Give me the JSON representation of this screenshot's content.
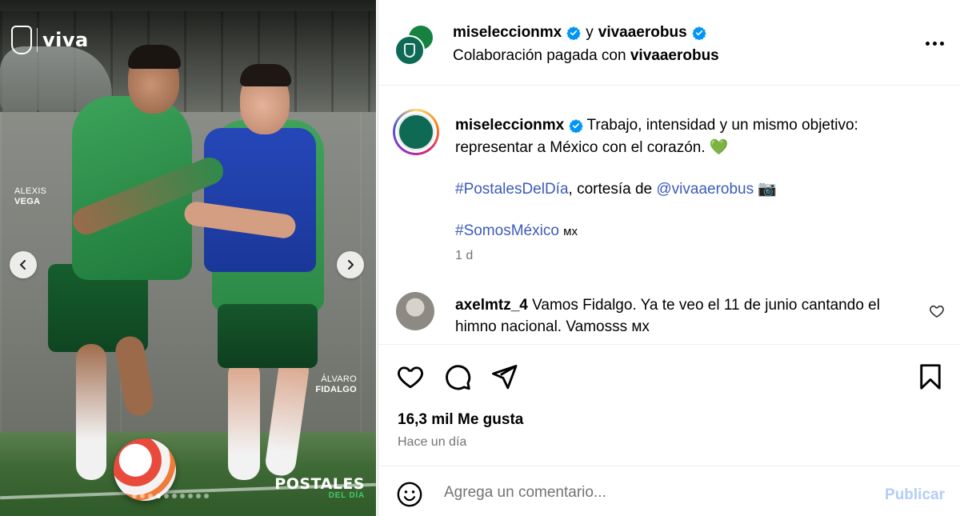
{
  "photo": {
    "logo_text": "viva",
    "player_left": {
      "first": "ALEXIS",
      "last": "VEGA"
    },
    "player_right": {
      "first": "ÁLVARO",
      "last": "FIDALGO"
    },
    "badge": {
      "title": "POSTALES",
      "subtitle": "DEL DÍA"
    },
    "carousel": {
      "total_dots": 10,
      "active_index": 3
    }
  },
  "header": {
    "account": "miseleccionmx",
    "joiner": "y",
    "collaborator": "vivaaerobus",
    "paid_label": "Colaboración pagada con",
    "paid_partner": "vivaaerobus"
  },
  "caption": {
    "user": "miseleccionmx",
    "line1": "Trabajo, intensidad y un mismo objetivo: representar a México con el corazón. 💚",
    "hashtag1": "#PostalesDelDía",
    "courtesy": ", cortesía de ",
    "mention": "@vivaaerobus",
    "camera": "📷",
    "hashtag2": "#SomosMéxico",
    "flag": "ᴍx",
    "age": "1 d"
  },
  "comment": {
    "user": "axelmtz_4",
    "text": "Vamos Fidalgo. Ya te veo el 11 de junio cantando el himno nacional. Vamosss ᴍx"
  },
  "stats": {
    "likes": "16,3 mil Me gusta",
    "posted": "Hace un día"
  },
  "composer": {
    "placeholder": "Agrega un comentario...",
    "publish_label": "Publicar"
  },
  "colors": {
    "verified": "#0095f6",
    "hashtag": "#3b5bb7",
    "publish_disabled": "#b2cdf7",
    "muted": "#737373"
  }
}
